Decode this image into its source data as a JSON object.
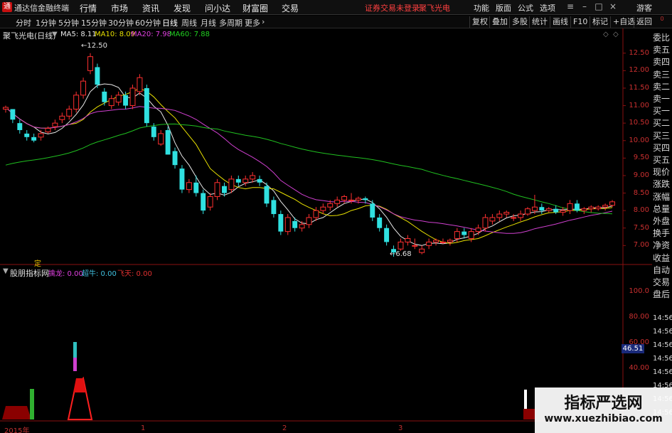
{
  "app": {
    "title": "通达信金融终端",
    "logo": "通"
  },
  "menu": [
    "行情",
    "市场",
    "资讯",
    "发现",
    "问小达",
    "财富圈",
    "交易"
  ],
  "login_status": "证券交易未登录",
  "stock_name": "聚飞光电",
  "right_menu": [
    "功能",
    "版面",
    "公式",
    "选项"
  ],
  "user": "游客",
  "periods": [
    "分时",
    "1分钟",
    "5分钟",
    "15分钟",
    "30分钟",
    "60分钟",
    "日线",
    "周线",
    "月线",
    "多周期",
    "更多"
  ],
  "active_period": "日线",
  "tools": [
    "复权",
    "叠加",
    "多股",
    "统计",
    "画线",
    "F10",
    "标记",
    "+自选",
    "返回"
  ],
  "chart_title": "聚飞光电(日线)",
  "ma": [
    {
      "label": "MA5: 8.11",
      "color": "#e8e8e8"
    },
    {
      "label": "MA10: 8.09",
      "color": "#e8e000"
    },
    {
      "label": "MA20: 7.98",
      "color": "#e040e0"
    },
    {
      "label": "MA60: 7.88",
      "color": "#20d020"
    }
  ],
  "high_label": "12.50",
  "low_label": "6.68",
  "indicator": {
    "name": "股朋指标网",
    "items": [
      {
        "label": "擒龙: 0.00",
        "color": "#e040e0"
      },
      {
        "label": "超牛: 0.00",
        "color": "#40c0e0"
      },
      {
        "label": "飞天: 0.00",
        "color": "#e03030"
      }
    ]
  },
  "price_axis": [
    "12.50",
    "12.00",
    "11.50",
    "11.00",
    "10.50",
    "10.00",
    "9.50",
    "9.00",
    "8.50",
    "8.00",
    "7.50",
    "7.00"
  ],
  "ind_axis": [
    "100.0",
    "80.00",
    "60.00",
    "40.00"
  ],
  "current_value": "46.51",
  "side_panel": [
    "委比",
    "卖五",
    "卖四",
    "卖三",
    "卖二",
    "卖一",
    "买一",
    "买二",
    "买三",
    "买四",
    "买五",
    "现价",
    "涨跌",
    "涨幅",
    "总量",
    "外盘",
    "换手",
    "净资",
    "收益",
    "自动",
    "交易",
    "盘后"
  ],
  "side_times": [
    "14:56",
    "14:56",
    "14:56",
    "14:56",
    "14:56",
    "14:56",
    "14:56",
    "14:56"
  ],
  "side_corner": "0",
  "date_axis": [
    "2015年",
    "1",
    "2",
    "3"
  ],
  "marker_label": "定",
  "watermark": {
    "title": "指标严选网",
    "url": "www.xuezhibiao.com"
  },
  "colors": {
    "up": "#ff3030",
    "down": "#30e0e0",
    "ma5": "#e8e8e8",
    "ma10": "#e8e000",
    "ma20": "#d040d0",
    "ma60": "#20c020"
  },
  "chart_data": {
    "type": "candlestick",
    "ylim": [
      6.6,
      12.8
    ],
    "candles": [
      [
        10.9,
        11.0,
        10.8,
        10.95
      ],
      [
        10.9,
        10.9,
        10.5,
        10.6
      ],
      [
        10.5,
        10.6,
        10.2,
        10.3
      ],
      [
        10.2,
        10.3,
        10.0,
        10.1
      ],
      [
        10.1,
        10.2,
        9.95,
        10.0
      ],
      [
        10.1,
        10.3,
        10.0,
        10.2
      ],
      [
        10.25,
        10.4,
        10.2,
        10.35
      ],
      [
        10.4,
        10.6,
        10.3,
        10.5
      ],
      [
        10.6,
        10.8,
        10.5,
        10.7
      ],
      [
        10.7,
        11.0,
        10.6,
        10.9
      ],
      [
        10.9,
        11.4,
        10.8,
        11.3
      ],
      [
        11.3,
        11.8,
        11.2,
        11.7
      ],
      [
        12.0,
        12.5,
        11.9,
        12.4
      ],
      [
        12.1,
        12.2,
        11.5,
        11.6
      ],
      [
        11.4,
        11.5,
        11.0,
        11.1
      ],
      [
        11.0,
        11.3,
        10.9,
        11.2
      ],
      [
        11.1,
        11.4,
        11.0,
        11.3
      ],
      [
        11.3,
        11.4,
        10.9,
        11.0
      ],
      [
        11.0,
        11.6,
        10.9,
        11.5
      ],
      [
        11.4,
        11.9,
        11.3,
        11.8
      ],
      [
        11.5,
        11.6,
        10.4,
        10.5
      ],
      [
        10.4,
        10.5,
        10.0,
        10.1
      ],
      [
        9.9,
        10.3,
        9.85,
        10.2
      ],
      [
        10.3,
        10.4,
        9.6,
        9.6
      ],
      [
        9.7,
        9.8,
        9.2,
        9.3
      ],
      [
        9.2,
        9.3,
        8.5,
        8.6
      ],
      [
        8.6,
        8.9,
        8.5,
        8.8
      ],
      [
        8.8,
        9.0,
        8.4,
        8.5
      ],
      [
        8.5,
        8.6,
        7.9,
        8.0
      ],
      [
        8.1,
        8.5,
        8.0,
        8.4
      ],
      [
        8.4,
        8.9,
        8.3,
        8.8
      ],
      [
        8.7,
        8.8,
        8.4,
        8.5
      ],
      [
        8.6,
        9.0,
        8.5,
        8.9
      ],
      [
        8.9,
        9.0,
        8.7,
        8.8
      ],
      [
        8.8,
        9.0,
        8.7,
        8.9
      ],
      [
        8.9,
        9.1,
        8.8,
        9.0
      ],
      [
        8.9,
        9.0,
        8.7,
        8.8
      ],
      [
        8.7,
        8.8,
        8.1,
        8.2
      ],
      [
        8.3,
        8.4,
        7.8,
        7.9
      ],
      [
        7.9,
        8.0,
        7.3,
        7.4
      ],
      [
        7.4,
        7.9,
        7.3,
        7.8
      ],
      [
        7.7,
        7.8,
        7.4,
        7.5
      ],
      [
        7.5,
        7.7,
        7.4,
        7.6
      ],
      [
        7.6,
        7.9,
        7.5,
        7.8
      ],
      [
        7.8,
        8.1,
        7.7,
        8.0
      ],
      [
        8.0,
        8.2,
        7.9,
        8.1
      ],
      [
        8.1,
        8.3,
        8.0,
        8.2
      ],
      [
        8.2,
        8.4,
        8.1,
        8.3
      ],
      [
        8.3,
        8.45,
        8.2,
        8.4
      ],
      [
        8.3,
        8.5,
        8.2,
        8.3
      ],
      [
        8.3,
        8.4,
        8.2,
        8.35
      ],
      [
        8.35,
        8.4,
        8.2,
        8.3
      ],
      [
        8.2,
        8.3,
        7.7,
        7.8
      ],
      [
        7.8,
        7.9,
        7.4,
        7.5
      ],
      [
        7.5,
        7.6,
        7.0,
        7.1
      ],
      [
        6.9,
        7.0,
        6.68,
        6.8
      ],
      [
        6.9,
        7.2,
        6.85,
        7.1
      ],
      [
        7.1,
        7.3,
        7.0,
        7.2
      ],
      [
        7.0,
        7.2,
        6.9,
        7.0
      ],
      [
        6.8,
        7.0,
        6.75,
        6.9
      ],
      [
        7.0,
        7.2,
        6.9,
        7.1
      ],
      [
        7.1,
        7.2,
        7.0,
        7.15
      ],
      [
        7.1,
        7.2,
        7.05,
        7.1
      ],
      [
        7.1,
        7.2,
        7.0,
        7.15
      ],
      [
        7.2,
        7.5,
        7.1,
        7.4
      ],
      [
        7.4,
        7.5,
        7.2,
        7.3
      ],
      [
        7.2,
        7.5,
        7.1,
        7.4
      ],
      [
        7.4,
        7.6,
        7.3,
        7.5
      ],
      [
        7.5,
        7.9,
        7.4,
        7.8
      ],
      [
        7.7,
        7.9,
        7.6,
        7.8
      ],
      [
        7.8,
        8.0,
        7.7,
        7.9
      ],
      [
        7.9,
        8.0,
        7.8,
        7.95
      ],
      [
        7.8,
        7.9,
        7.7,
        7.8
      ],
      [
        7.8,
        8.0,
        7.7,
        7.9
      ],
      [
        7.9,
        8.1,
        7.85,
        8.05
      ],
      [
        8.0,
        8.45,
        7.9,
        8.1
      ],
      [
        8.1,
        8.2,
        7.9,
        8.0
      ],
      [
        8.0,
        8.1,
        7.95,
        8.05
      ],
      [
        8.05,
        8.15,
        7.9,
        7.95
      ],
      [
        7.95,
        8.1,
        7.85,
        8.0
      ],
      [
        8.0,
        8.3,
        7.9,
        8.2
      ],
      [
        8.2,
        8.3,
        7.95,
        8.0
      ],
      [
        8.0,
        8.1,
        7.9,
        8.05
      ],
      [
        8.05,
        8.15,
        7.95,
        8.1
      ],
      [
        8.05,
        8.15,
        8.0,
        8.1
      ],
      [
        8.1,
        8.2,
        8.0,
        8.15
      ],
      [
        8.15,
        8.3,
        8.1,
        8.25
      ]
    ]
  }
}
